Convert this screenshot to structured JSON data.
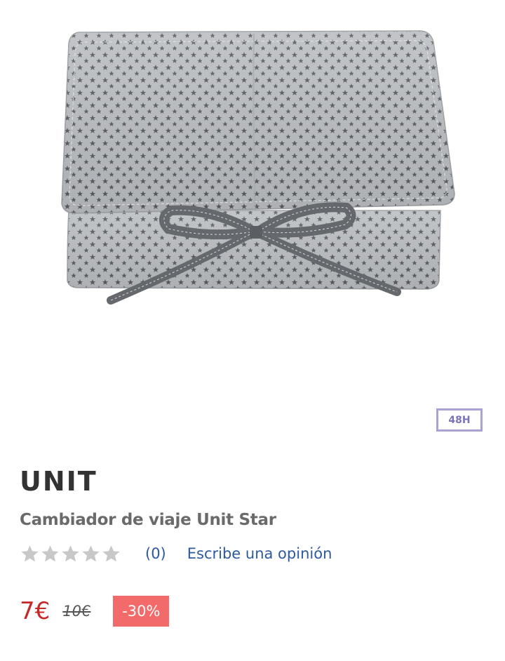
{
  "product": {
    "image_alt": "Cambiador de viaje Unit Star",
    "delivery_badge": "48H",
    "brand": "UNIT",
    "name": "Cambiador de viaje Unit Star",
    "rating": {
      "stars_filled": 0,
      "stars_total": 5,
      "review_count": "(0)",
      "write_review_label": "Escribe una opinión"
    },
    "price": {
      "current": "7€",
      "original": "10€",
      "discount": "-30%"
    }
  },
  "colors": {
    "fabric": "#b9bcc0",
    "stars_pattern": "#5d6065",
    "ribbon": "#65686c",
    "badge_border": "#a8a2d6",
    "price": "#c62828",
    "discount_bg": "#f26a6a",
    "link": "#2c5aa0",
    "rating_star": "#c8c8c8"
  }
}
